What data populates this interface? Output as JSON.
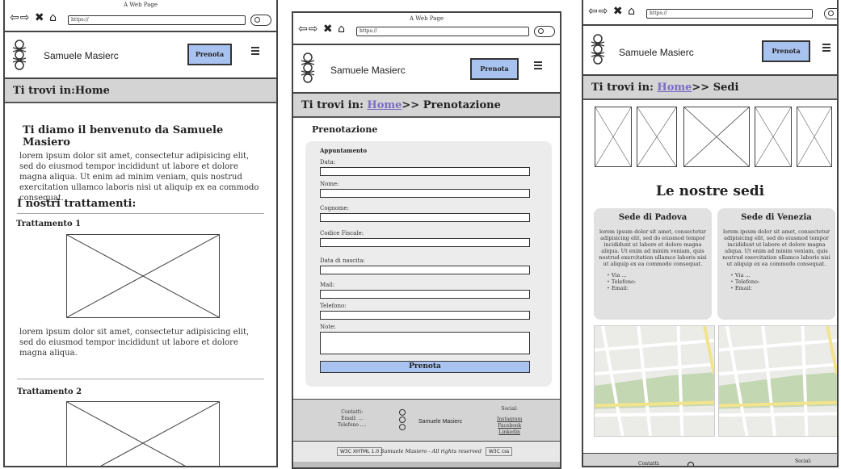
{
  "browser": {
    "title": "A Web Page",
    "url": "https://",
    "nav_icons": "⇦⇨ ✖ ⌂"
  },
  "brand": {
    "name": "Samuele Masierc"
  },
  "menu": {
    "prenota_label": "Prenota"
  },
  "home": {
    "crumb_prefix": "Ti trovi in:",
    "crumb_current": "Home",
    "welcome_title": "Ti diamo il benvenuto da Samuele Masiero",
    "welcome_text": "lorem ipsum dolor sit amet, consectetur adipisicing elit, sed do eiusmod tempor incididunt ut labore et dolore magna aliqua. Ut enim ad minim veniam, quis nostrud exercitation ullamco laboris nisi ut aliquip ex ea commodo consequat.",
    "treatments_title": "I nostri trattamenti:",
    "treatment1_title": "Trattamento 1",
    "treatment1_text": "lorem ipsum dolor sit amet, consectetur adipisicing elit, sed do eiusmod tempor incididunt ut labore et dolore magna aliqua.",
    "treatment2_title": "Trattamento 2"
  },
  "booking": {
    "crumb_prefix": "Ti trovi in:",
    "crumb_home": "Home",
    "crumb_sep": ">>",
    "crumb_current": "Prenotazione",
    "title": "Prenotazione",
    "form_title": "Appuntamento",
    "fields": [
      "Data:",
      "Nome:",
      "Cognome:",
      "Codice Fiscale:",
      "Data di nascita:",
      "Mail:",
      "Telefono:",
      "Note:"
    ],
    "submit": "Prenota",
    "footer": {
      "contacts": [
        "Contatti:",
        "Email: ...",
        "Telefono ...."
      ],
      "brand": "Samuele Masierc",
      "social_title": "Social:",
      "social": [
        "Instagram",
        "Facebook",
        "Linkedin"
      ],
      "copyright": "Samuele Masiero - All rights reserved",
      "badge_xhtml": "W3C XHTML 1.0",
      "badge_css": "W3C css"
    }
  },
  "sedi": {
    "crumb_prefix": "Ti trovi in:",
    "crumb_home": "Home",
    "crumb_sep": ">>",
    "crumb_current": "Sedi",
    "title": "Le nostre sedi",
    "cards": [
      {
        "title": "Sede di Padova",
        "text": "lorem ipsum dolor sit amet, consectetur adipisicing elit, sed do eiusmod tempor incididunt ut labore et dolore magna aliqua. Ut enim ad minim veniam, quis nostrud exercitation ullamco laboris nisi ut aliquip ex ea commodo consequat.",
        "items": [
          "Via ...",
          "Telefono:",
          "Email:"
        ]
      },
      {
        "title": "Sede di Venezia",
        "text": "lorem ipsum dolor sit amet, consectetur adipisicing elit, sed do eiusmod tempor incididunt ut labore et dolore magna aliqua. Ut enim ad minim veniam, quis nostrud exercitation ullamco laboris nisi ut aliquip ex ea commodo consequat.",
        "items": [
          "Via ...",
          "Telefono:",
          "Email:"
        ]
      }
    ],
    "footer": {
      "contacts": "Contatti:",
      "social_title": "Social:"
    }
  },
  "colors": {
    "accent": "#7b6cc5",
    "button": "#a9c3f0",
    "crumb_bg": "#d4d4d4"
  }
}
